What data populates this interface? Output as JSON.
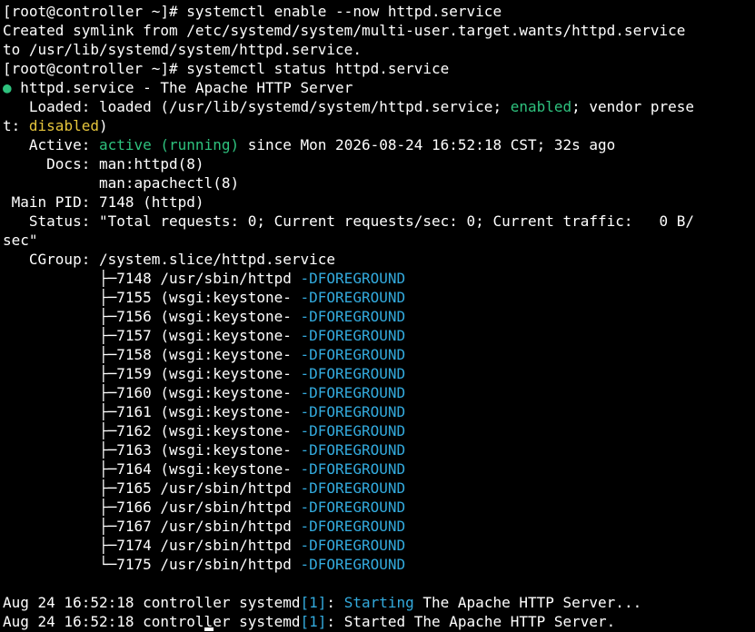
{
  "colors": {
    "background": "#000000",
    "foreground": "#ffffff",
    "green": "#2ec27e",
    "yellow": "#e5c53c",
    "cyan": "#33aadd"
  },
  "lines": [
    [
      {
        "t": "[root@controller ~]# systemctl enable --now httpd.service"
      }
    ],
    [
      {
        "t": "Created symlink from /etc/systemd/system/multi-user.target.wants/httpd.service"
      }
    ],
    [
      {
        "t": "to /usr/lib/systemd/system/httpd.service."
      }
    ],
    [
      {
        "t": "[root@controller ~]# systemctl status httpd.service"
      }
    ],
    [
      {
        "t": "●",
        "c": "bullet"
      },
      {
        "t": " httpd.service - The Apache HTTP Server"
      }
    ],
    [
      {
        "t": "   Loaded: loaded (/usr/lib/systemd/system/httpd.service; "
      },
      {
        "t": "enabled",
        "c": "green"
      },
      {
        "t": "; vendor prese"
      }
    ],
    [
      {
        "t": "t: "
      },
      {
        "t": "disabled",
        "c": "yellow"
      },
      {
        "t": ")"
      }
    ],
    [
      {
        "t": "   Active: "
      },
      {
        "t": "active (running)",
        "c": "green"
      },
      {
        "t": " since Mon 2026-08-24 16:52:18 CST; 32s ago"
      }
    ],
    [
      {
        "t": "     Docs: man:httpd(8)"
      }
    ],
    [
      {
        "t": "           man:apachectl(8)"
      }
    ],
    [
      {
        "t": " Main PID: 7148 (httpd)"
      }
    ],
    [
      {
        "t": "   Status: \"Total requests: 0; Current requests/sec: 0; Current traffic:   0 B/"
      }
    ],
    [
      {
        "t": "sec\""
      }
    ],
    [
      {
        "t": "   CGroup: /system.slice/httpd.service"
      }
    ],
    [
      {
        "t": "           ├─7148 /usr/sbin/httpd "
      },
      {
        "t": "-DFOREGROUND",
        "c": "cyan"
      }
    ],
    [
      {
        "t": "           ├─7155 (wsgi:keystone- "
      },
      {
        "t": "-DFOREGROUND",
        "c": "cyan"
      }
    ],
    [
      {
        "t": "           ├─7156 (wsgi:keystone- "
      },
      {
        "t": "-DFOREGROUND",
        "c": "cyan"
      }
    ],
    [
      {
        "t": "           ├─7157 (wsgi:keystone- "
      },
      {
        "t": "-DFOREGROUND",
        "c": "cyan"
      }
    ],
    [
      {
        "t": "           ├─7158 (wsgi:keystone- "
      },
      {
        "t": "-DFOREGROUND",
        "c": "cyan"
      }
    ],
    [
      {
        "t": "           ├─7159 (wsgi:keystone- "
      },
      {
        "t": "-DFOREGROUND",
        "c": "cyan"
      }
    ],
    [
      {
        "t": "           ├─7160 (wsgi:keystone- "
      },
      {
        "t": "-DFOREGROUND",
        "c": "cyan"
      }
    ],
    [
      {
        "t": "           ├─7161 (wsgi:keystone- "
      },
      {
        "t": "-DFOREGROUND",
        "c": "cyan"
      }
    ],
    [
      {
        "t": "           ├─7162 (wsgi:keystone- "
      },
      {
        "t": "-DFOREGROUND",
        "c": "cyan"
      }
    ],
    [
      {
        "t": "           ├─7163 (wsgi:keystone- "
      },
      {
        "t": "-DFOREGROUND",
        "c": "cyan"
      }
    ],
    [
      {
        "t": "           ├─7164 (wsgi:keystone- "
      },
      {
        "t": "-DFOREGROUND",
        "c": "cyan"
      }
    ],
    [
      {
        "t": "           ├─7165 /usr/sbin/httpd "
      },
      {
        "t": "-DFOREGROUND",
        "c": "cyan"
      }
    ],
    [
      {
        "t": "           ├─7166 /usr/sbin/httpd "
      },
      {
        "t": "-DFOREGROUND",
        "c": "cyan"
      }
    ],
    [
      {
        "t": "           ├─7167 /usr/sbin/httpd "
      },
      {
        "t": "-DFOREGROUND",
        "c": "cyan"
      }
    ],
    [
      {
        "t": "           ├─7174 /usr/sbin/httpd "
      },
      {
        "t": "-DFOREGROUND",
        "c": "cyan"
      }
    ],
    [
      {
        "t": "           └─7175 /usr/sbin/httpd "
      },
      {
        "t": "-DFOREGROUND",
        "c": "cyan"
      }
    ],
    [
      {
        "t": ""
      }
    ],
    [
      {
        "t": "Aug 24 16:52:18 controller systemd"
      },
      {
        "t": "[1]",
        "c": "cyan"
      },
      {
        "t": ": "
      },
      {
        "t": "Starting",
        "c": "cyan"
      },
      {
        "t": " The Apache HTTP Server..."
      }
    ],
    [
      {
        "t": "Aug 24 16:52:18 controller systemd"
      },
      {
        "t": "[1]",
        "c": "cyan"
      },
      {
        "t": ": Started The Apache HTTP Server."
      }
    ]
  ],
  "cursor_line": 32
}
